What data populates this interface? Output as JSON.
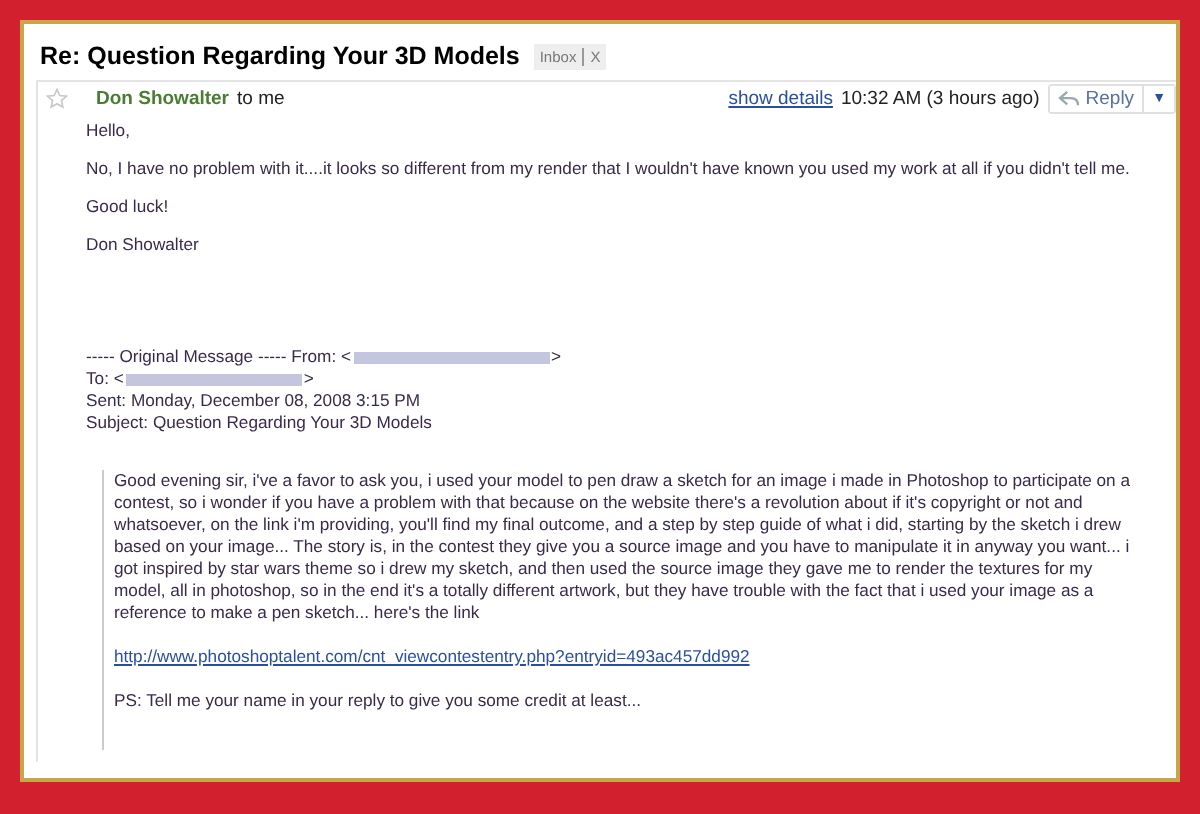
{
  "subject": "Re: Question Regarding Your 3D Models",
  "label": {
    "text": "Inbox",
    "close": "X"
  },
  "message": {
    "starred": false,
    "sender": "Don Showalter",
    "recipient": "to me",
    "details_link": "show details",
    "time": "10:32 AM (3 hours ago)",
    "reply": "Reply",
    "reply_menu": "▼",
    "body": [
      "Hello,",
      "No, I have no problem with it....it looks so different from my render that I wouldn't have known you used my work at all if you didn't tell me.",
      "Good luck!",
      "Don Showalter"
    ],
    "original": {
      "from_label": "----- Original Message ----- From: <",
      "from_end": ">",
      "to_label": "To: <",
      "to_end": ">",
      "sent": "Sent: Monday, December 08, 2008 3:15 PM",
      "subject": "Subject: Question Regarding Your 3D Models"
    },
    "quoted": [
      "Good evening sir, i've a favor to ask you, i used your model to pen draw a sketch for an image i made in Photoshop to participate on a contest, so i wonder if you have a problem with that because on the website there's a revolution about if it's copyright or not and whatsoever, on the link i'm providing, you'll find my final outcome, and a step by step guide of what i did, starting by the sketch i drew based on your image... The story is, in the contest they give you a source image and you have to manipulate it in anyway you want... i got inspired by star wars theme so i drew my sketch, and then used the source image they gave me to render the textures for my model, all in photoshop, so in the end it's a totally different artwork, but they have trouble with the fact that i used your image as a reference to make a pen sketch... here's the link"
    ],
    "quoted_link": "http://www.photoshoptalent.com/cnt_viewcontestentry.php?entryid=493ac457dd992",
    "quoted_ps": "PS: Tell me your name in your reply to give you some credit at least..."
  }
}
